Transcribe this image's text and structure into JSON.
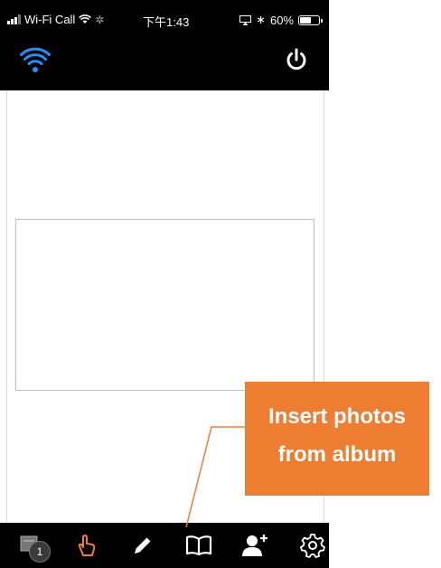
{
  "status_bar": {
    "carrier": "Wi-Fi Call",
    "time": "下午1:43",
    "battery_text": "60%",
    "battery_level": 0.6
  },
  "top_bar": {
    "wifi_icon": "wifi-icon",
    "power_icon": "power-icon",
    "wifi_color": "#1e90ff"
  },
  "toolbar": {
    "page_count": "1",
    "items": [
      "pages-icon",
      "hand-pointer-icon",
      "pencil-icon",
      "book-icon",
      "add-user-icon",
      "gear-icon"
    ],
    "hand_color": "#ed7d31"
  },
  "callout": {
    "line1": "Insert photos",
    "line2": "from album",
    "color": "#ed7d31"
  }
}
